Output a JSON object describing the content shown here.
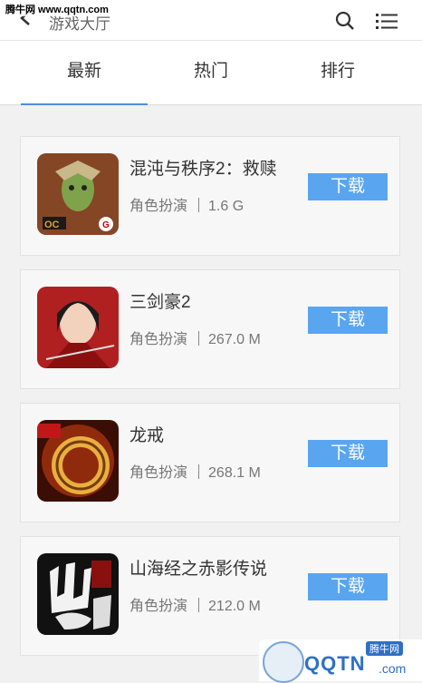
{
  "watermark": "腾牛网 www.qqtn.com",
  "header": {
    "title": "游戏大厅",
    "back_icon": "back-arrow-icon",
    "search_icon": "search-icon",
    "menu_icon": "list-menu-icon"
  },
  "tabs": [
    {
      "label": "最新",
      "active": true
    },
    {
      "label": "热门",
      "active": false
    },
    {
      "label": "排行",
      "active": false
    }
  ],
  "games": [
    {
      "name": "混沌与秩序2：救赎",
      "category": "角色扮演",
      "size": "1.6 G",
      "download_label": "下载",
      "icon": "chaos-order-icon"
    },
    {
      "name": "三剑豪2",
      "category": "角色扮演",
      "size": "267.0 M",
      "download_label": "下载",
      "icon": "three-swords-icon"
    },
    {
      "name": "龙戒",
      "category": "角色扮演",
      "size": "268.1 M",
      "download_label": "下载",
      "icon": "dragon-ring-icon"
    },
    {
      "name": "山海经之赤影传说",
      "category": "角色扮演",
      "size": "212.0 M",
      "download_label": "下载",
      "icon": "shanhaijing-icon"
    }
  ],
  "corner_logo": {
    "badge": "腾牛网",
    "brand": "QQTN",
    "suffix": ".com"
  },
  "colors": {
    "accent": "#4a90e2",
    "download": "#5aa5f0"
  }
}
